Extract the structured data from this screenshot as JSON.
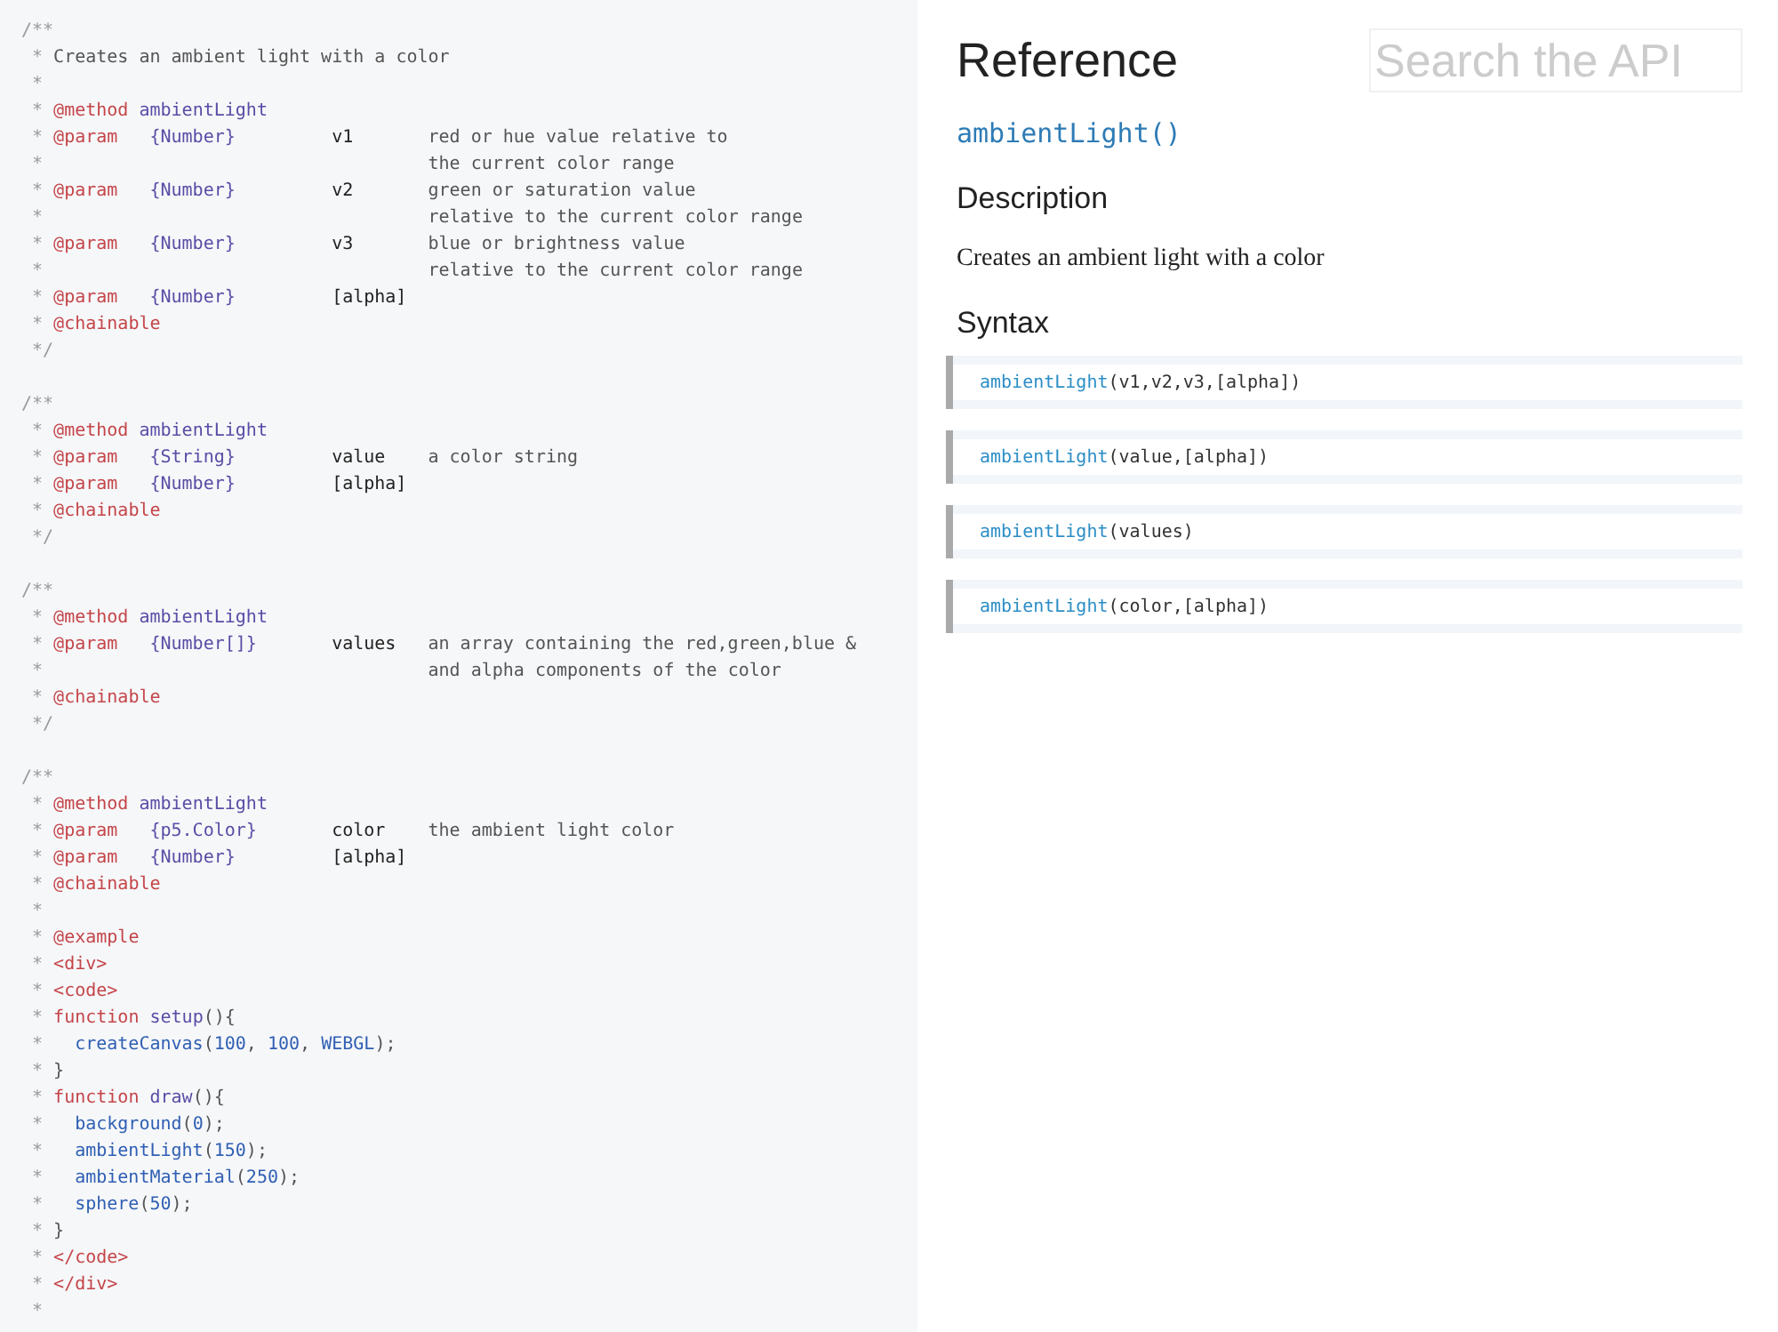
{
  "source_code": {
    "blocks": [
      {
        "lines": [
          {
            "kind": "open",
            "text": "/**"
          },
          {
            "kind": "comment",
            "prefix": "*",
            "text": "Creates an ambient light with a color"
          },
          {
            "kind": "comment",
            "prefix": "*"
          },
          {
            "kind": "tag",
            "prefix": "*",
            "tag": "@method",
            "name": "ambientLight"
          },
          {
            "kind": "param",
            "prefix": "*",
            "tag": "@param",
            "type": "{Number}",
            "name": "v1",
            "text": "red or hue value relative to"
          },
          {
            "kind": "cont",
            "prefix": "*",
            "text": "the current color range"
          },
          {
            "kind": "param",
            "prefix": "*",
            "tag": "@param",
            "type": "{Number}",
            "name": "v2",
            "text": "green or saturation value"
          },
          {
            "kind": "cont",
            "prefix": "*",
            "text": "relative to the current color range"
          },
          {
            "kind": "param",
            "prefix": "*",
            "tag": "@param",
            "type": "{Number}",
            "name": "v3",
            "text": "blue or brightness value"
          },
          {
            "kind": "cont",
            "prefix": "*",
            "text": "relative to the current color range"
          },
          {
            "kind": "param",
            "prefix": "*",
            "tag": "@param",
            "type": "{Number}",
            "name": "[alpha]"
          },
          {
            "kind": "tag",
            "prefix": "*",
            "tag": "@chainable"
          },
          {
            "kind": "close",
            "text": "*/"
          }
        ]
      },
      {
        "lines": [
          {
            "kind": "open",
            "text": "/**"
          },
          {
            "kind": "tag",
            "prefix": "*",
            "tag": "@method",
            "name": "ambientLight"
          },
          {
            "kind": "param",
            "prefix": "*",
            "tag": "@param",
            "type": "{String}",
            "name": "value",
            "text": "a color string"
          },
          {
            "kind": "param",
            "prefix": "*",
            "tag": "@param",
            "type": "{Number}",
            "name": "[alpha]"
          },
          {
            "kind": "tag",
            "prefix": "*",
            "tag": "@chainable"
          },
          {
            "kind": "close",
            "text": "*/"
          }
        ]
      },
      {
        "lines": [
          {
            "kind": "open",
            "text": "/**"
          },
          {
            "kind": "tag",
            "prefix": "*",
            "tag": "@method",
            "name": "ambientLight"
          },
          {
            "kind": "param",
            "prefix": "*",
            "tag": "@param",
            "type": "{Number[]}",
            "name": "values",
            "text": "an array containing the red,green,blue &"
          },
          {
            "kind": "cont",
            "prefix": "*",
            "text": "and alpha components of the color"
          },
          {
            "kind": "tag",
            "prefix": "*",
            "tag": "@chainable"
          },
          {
            "kind": "close",
            "text": "*/"
          }
        ]
      },
      {
        "lines": [
          {
            "kind": "open",
            "text": "/**"
          },
          {
            "kind": "tag",
            "prefix": "*",
            "tag": "@method",
            "name": "ambientLight"
          },
          {
            "kind": "param",
            "prefix": "*",
            "tag": "@param",
            "type": "{p5.Color}",
            "name": "color",
            "text": "the ambient light color"
          },
          {
            "kind": "param",
            "prefix": "*",
            "tag": "@param",
            "type": "{Number}",
            "name": "[alpha]"
          },
          {
            "kind": "tag",
            "prefix": "*",
            "tag": "@chainable"
          },
          {
            "kind": "comment",
            "prefix": "*"
          },
          {
            "kind": "tag",
            "prefix": "*",
            "tag": "@example"
          },
          {
            "kind": "tag",
            "prefix": "*",
            "tag": "<div>"
          },
          {
            "kind": "tag",
            "prefix": "*",
            "tag": "<code>"
          },
          {
            "kind": "func",
            "prefix": "*",
            "tag": "function",
            "name": "setup",
            "text": "(){"
          },
          {
            "kind": "call",
            "prefix": "*",
            "name": "createCanvas",
            "text": "(100, 100, WEBGL);"
          },
          {
            "kind": "comment",
            "prefix": "*",
            "text": "}"
          },
          {
            "kind": "func",
            "prefix": "*",
            "tag": "function",
            "name": "draw",
            "text": "(){"
          },
          {
            "kind": "call",
            "prefix": "*",
            "name": "background",
            "text": "(0);"
          },
          {
            "kind": "call",
            "prefix": "*",
            "name": "ambientLight",
            "text": "(150);"
          },
          {
            "kind": "call",
            "prefix": "*",
            "name": "ambientMaterial",
            "text": "(250);"
          },
          {
            "kind": "call",
            "prefix": "*",
            "name": "sphere",
            "text": "(50);"
          },
          {
            "kind": "comment",
            "prefix": "*",
            "text": "}"
          },
          {
            "kind": "tag",
            "prefix": "*",
            "tag": "</code>"
          },
          {
            "kind": "tag",
            "prefix": "*",
            "tag": "</div>"
          },
          {
            "kind": "comment",
            "prefix": "*"
          }
        ]
      }
    ]
  },
  "reference": {
    "title": "Reference",
    "search": {
      "placeholder": "Search the API"
    },
    "method": "ambientLight()",
    "description_heading": "Description",
    "description": "Creates an ambient light with a color",
    "syntax_heading": "Syntax",
    "syntax": [
      {
        "name": "ambientLight",
        "args": "(v1,v2,v3,[alpha])"
      },
      {
        "name": "ambientLight",
        "args": "(value,[alpha])"
      },
      {
        "name": "ambientLight",
        "args": "(values)"
      },
      {
        "name": "ambientLight",
        "args": "(color,[alpha])"
      }
    ]
  }
}
